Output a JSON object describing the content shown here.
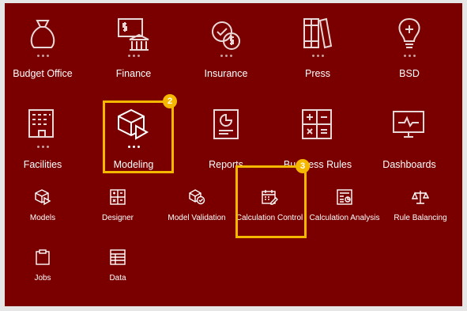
{
  "cards": [
    {
      "label": "Budget Office",
      "icon": "money-bag-icon"
    },
    {
      "label": "Finance",
      "icon": "finance-bank-icon"
    },
    {
      "label": "Insurance",
      "icon": "insurance-coins-icon"
    },
    {
      "label": "Press",
      "icon": "press-books-icon"
    },
    {
      "label": "BSD",
      "icon": "lightbulb-icon"
    },
    {
      "label": "Facilities",
      "icon": "building-icon"
    },
    {
      "label": "Modeling",
      "icon": "cube-play-icon"
    },
    {
      "label": "Reports",
      "icon": "report-chart-icon"
    },
    {
      "label": "Business Rules",
      "icon": "calculator-icon"
    },
    {
      "label": "Dashboards",
      "icon": "monitor-chart-icon"
    }
  ],
  "sub_items": [
    {
      "label": "Models",
      "icon": "cube-play-icon"
    },
    {
      "label": "Designer",
      "icon": "grid-designer-icon"
    },
    {
      "label": "Model Validation",
      "icon": "cube-check-icon"
    },
    {
      "label": "Calculation Control",
      "icon": "calendar-edit-icon"
    },
    {
      "label": "Calculation Analysis",
      "icon": "analysis-form-icon"
    },
    {
      "label": "Rule Balancing",
      "icon": "scale-balance-icon"
    },
    {
      "label": "Jobs",
      "icon": "clipboard-icon"
    },
    {
      "label": "Data",
      "icon": "data-table-icon"
    }
  ],
  "callouts": [
    {
      "number": "2"
    },
    {
      "number": "3"
    }
  ],
  "colors": {
    "panel": "#7a0000",
    "highlight": "#f5b800",
    "icon_stroke": "#e9d8d8"
  }
}
